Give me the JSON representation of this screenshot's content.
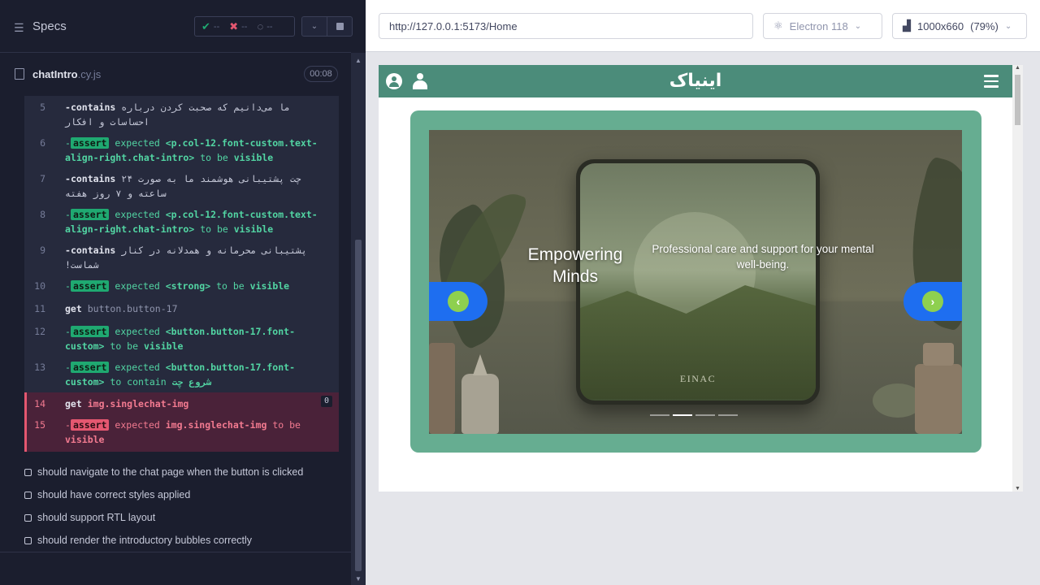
{
  "runner": {
    "header": {
      "title": "Specs",
      "stats": {
        "passed": "--",
        "failed": "--",
        "pending": "--"
      }
    },
    "spec": {
      "name": "chatIntro",
      "ext": ".cy.js",
      "duration": "00:08"
    },
    "commands": [
      {
        "num": "5",
        "dash": "-",
        "keyword": "contains",
        "text": "ما می‌دانیم که صحبت کردن درباره احساسات و افکار"
      },
      {
        "num": "6",
        "dash": "-",
        "badge": "assert",
        "w1": "expected",
        "subject": "<p.col-12.font-custom.text-align-right.chat-intro>",
        "w2": "to be",
        "w3": "visible"
      },
      {
        "num": "7",
        "dash": "-",
        "keyword": "contains",
        "text": "چت پشتیبانی هوشمند ما به صورت ۲۴ ساعته و ۷ روز هفته"
      },
      {
        "num": "8",
        "dash": "-",
        "badge": "assert",
        "w1": "expected",
        "subject": "<p.col-12.font-custom.text-align-right.chat-intro>",
        "w2": "to be",
        "w3": "visible"
      },
      {
        "num": "9",
        "dash": "-",
        "keyword": "contains",
        "text": "پشتیبانی محرمانه و همدلانه در کنار شماست!"
      },
      {
        "num": "10",
        "dash": "-",
        "badge": "assert",
        "w1": "expected",
        "subject": "<strong>",
        "w2": "to be",
        "w3": "visible"
      },
      {
        "num": "11",
        "keyword": "get",
        "text": "button.button-17"
      },
      {
        "num": "12",
        "dash": "-",
        "badge": "assert",
        "w1": "expected",
        "subject": "<button.button-17.font-custom>",
        "w2": "to be",
        "w3": "visible"
      },
      {
        "num": "13",
        "dash": "-",
        "badge": "assert",
        "w1": "expected",
        "subject": "<button.button-17.font-custom>",
        "w2": "to contain",
        "w3": "شروع چت"
      },
      {
        "num": "14",
        "keyword": "get",
        "text": "img.singlechat-img",
        "count": "0"
      },
      {
        "num": "15",
        "dash": "-",
        "badge": "assert",
        "w1": "expected",
        "subject": "img.singlechat-img",
        "w2": "to be",
        "w3": "visible"
      }
    ],
    "tests": [
      "should navigate to the chat page when the button is clicked",
      "should have correct styles applied",
      "should support RTL layout",
      "should render the introductory bubbles correctly"
    ]
  },
  "browser": {
    "url": "http://127.0.0.1:5173/Home",
    "engine": "Electron 118",
    "viewport": "1000x660",
    "zoom": "(79%)"
  },
  "app": {
    "brand": "اینیاک",
    "carousel": {
      "title": "Empowering Minds",
      "description": "Professional care and support for your mental well-being.",
      "device_label": "EINAC",
      "indicators": 4,
      "active_index": 1,
      "prev_glyph": "‹",
      "next_glyph": "›"
    }
  },
  "colors": {
    "pass": "#1fa971",
    "fail": "#e45770",
    "app_nav": "#4b8c7a",
    "carousel_frame": "#66ad91",
    "carousel_button": "#1e6ef0",
    "carousel_button_icon": "#8ed04f"
  }
}
